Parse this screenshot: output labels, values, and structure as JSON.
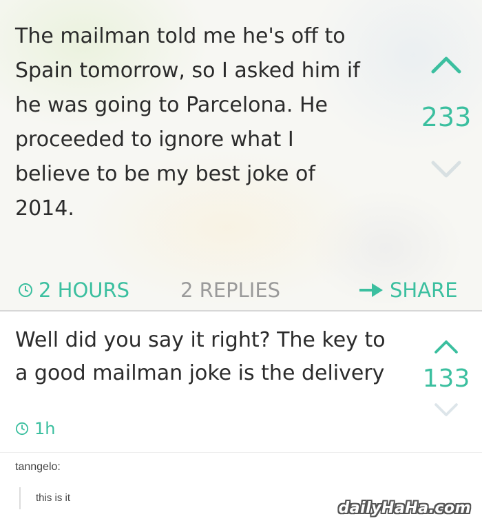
{
  "post": {
    "text": "The mailman told me he's off to\nSpain tomorrow, so I asked him if\nhe was going to Parcelona. He\nproceeded to ignore what I\nbelieve to be my best joke of\n2014.",
    "score": "233",
    "time": "2 HOURS",
    "replies": "2 REPLIES",
    "share": "SHARE"
  },
  "reply": {
    "text": "Well did you say it right? The key to\na good mailman joke is the delivery",
    "score": "133",
    "time": "1h"
  },
  "tumblr": {
    "username": "tanngelo:",
    "quote": "this is it"
  },
  "watermark": "dailyHaHa.com",
  "colors": {
    "accent": "#3bbf9f",
    "text": "#2b2b2b",
    "muted": "#9a9a9a"
  },
  "icons": [
    "chevron-up-icon",
    "chevron-down-icon",
    "clock-icon",
    "share-arrow-icon"
  ]
}
